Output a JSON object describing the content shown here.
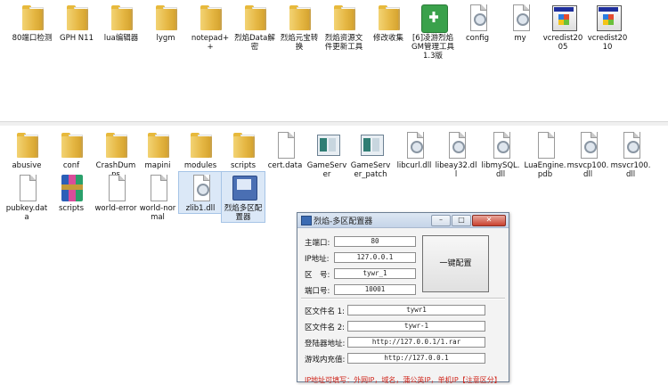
{
  "top_row": [
    {
      "label": "80端口检测",
      "kind": "folder"
    },
    {
      "label": "GPH N11",
      "kind": "folder"
    },
    {
      "label": "lua编辑器",
      "kind": "folder"
    },
    {
      "label": "lygm",
      "kind": "folder"
    },
    {
      "label": "notepad++",
      "kind": "folder"
    },
    {
      "label": "烈焰Data解密",
      "kind": "folder"
    },
    {
      "label": "烈焰元宝转换",
      "kind": "folder"
    },
    {
      "label": "烈焰资源文件更新工具",
      "kind": "folder"
    },
    {
      "label": "修改收集",
      "kind": "folder"
    },
    {
      "label": "[6]凌游烈焰GM管理工具1.3版",
      "kind": "greenkit"
    },
    {
      "label": "config",
      "kind": "file"
    },
    {
      "label": "my",
      "kind": "file"
    },
    {
      "label": "vcredist2005",
      "kind": "installer"
    },
    {
      "label": "vcredist2010",
      "kind": "installer"
    }
  ],
  "bottom_row1": [
    {
      "label": "abusive",
      "kind": "folder"
    },
    {
      "label": "conf",
      "kind": "folder"
    },
    {
      "label": "CrashDumps",
      "kind": "folder"
    },
    {
      "label": "mapini",
      "kind": "folder"
    },
    {
      "label": "modules",
      "kind": "folder"
    },
    {
      "label": "scripts",
      "kind": "folder"
    },
    {
      "label": "cert.data",
      "kind": "page"
    },
    {
      "label": "GameServer",
      "kind": "appwin"
    },
    {
      "label": "GameServer_patch",
      "kind": "appwin"
    },
    {
      "label": "libcurl.dll",
      "kind": "file"
    },
    {
      "label": "libeay32.dll",
      "kind": "file"
    },
    {
      "label": "libmySQL.dll",
      "kind": "file"
    },
    {
      "label": "LuaEngine.pdb",
      "kind": "page"
    },
    {
      "label": "msvcp100.dll",
      "kind": "file"
    },
    {
      "label": "msvcr100.dll",
      "kind": "file"
    }
  ],
  "bottom_row2": [
    {
      "label": "pubkey.data",
      "kind": "page"
    },
    {
      "label": "scripts",
      "kind": "rar"
    },
    {
      "label": "world-error",
      "kind": "page"
    },
    {
      "label": "world-normal",
      "kind": "page"
    },
    {
      "label": "zlib1.dll",
      "kind": "file"
    },
    {
      "label": "烈焰多区配置器",
      "kind": "cfgtool"
    }
  ],
  "dialog": {
    "title": "烈焰-多区配置器",
    "window_buttons": {
      "minimize": "–",
      "maximize": "□",
      "close": "✕"
    },
    "fields": [
      {
        "label": "主端口:",
        "value": "80"
      },
      {
        "label": "IP地址:",
        "value": "127.0.0.1"
      },
      {
        "label": "区　号:",
        "value": "tywr_1"
      },
      {
        "label": "端口号:",
        "value": "10001"
      }
    ],
    "one_key_button": "一键配置",
    "lower_fields": [
      {
        "label": "区文件名 1:",
        "value": "tywr1"
      },
      {
        "label": "区文件名 2:",
        "value": "tywr-1"
      },
      {
        "label": "登陆器地址:",
        "value": "http://127.0.0.1/1.rar"
      },
      {
        "label": "游戏内充值:",
        "value": "http://127.0.0.1"
      }
    ],
    "hint": "IP地址可填写：外网IP，域名，蒲公英IP，单机IP【注意区分】"
  }
}
